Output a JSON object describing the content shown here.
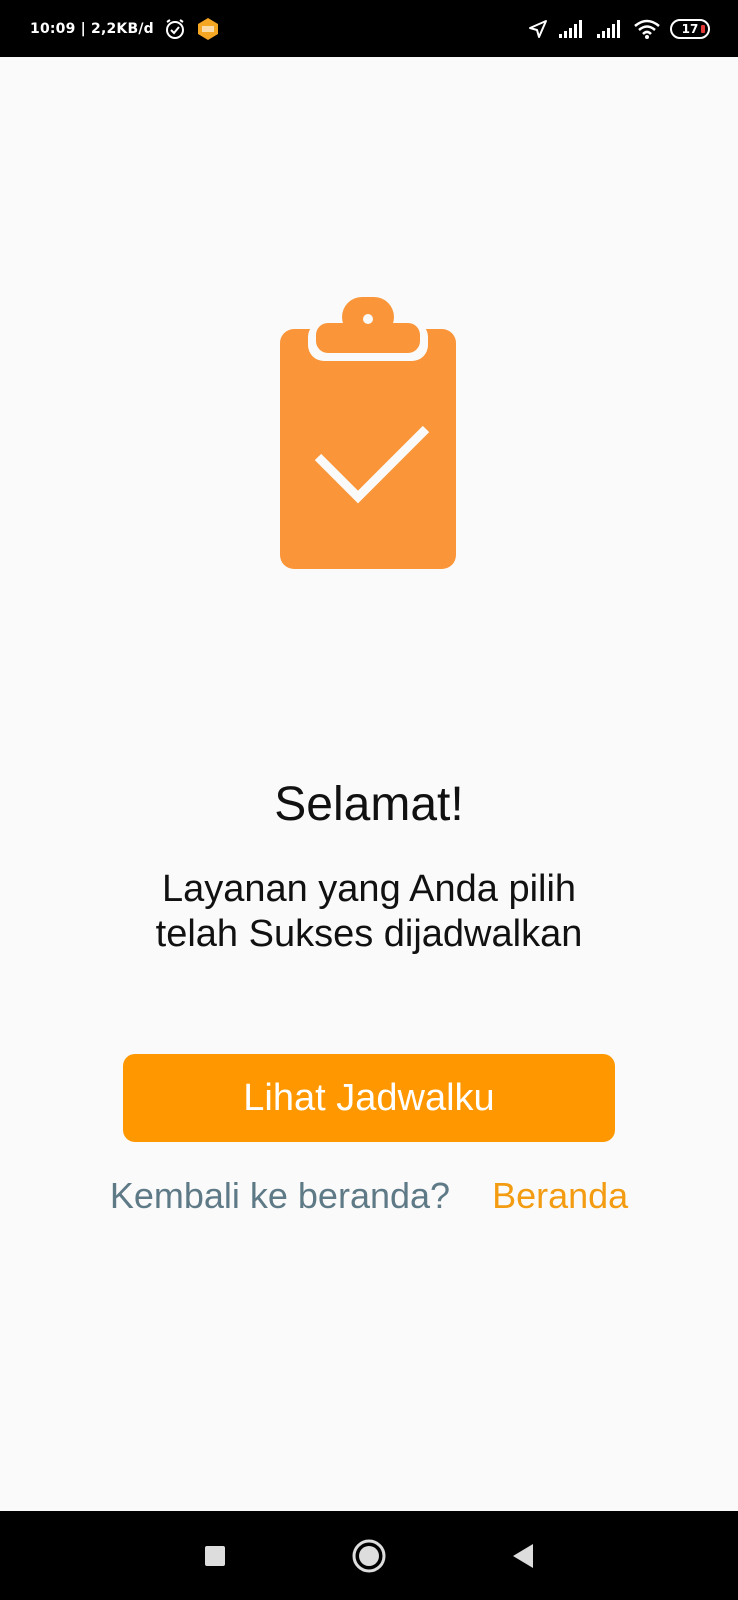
{
  "status_bar": {
    "time": "10:09 | 2,2KB/d",
    "battery": "17",
    "icons": [
      "alarm-icon",
      "app-notification-icon",
      "location-icon",
      "signal-icon",
      "signal-icon",
      "wifi-icon",
      "battery-icon"
    ]
  },
  "colors": {
    "accent": "#FF9800",
    "icon": "#FA9639",
    "link": "#F39C12",
    "muted_text": "#5F7A87",
    "background": "#FAFAFA"
  },
  "success": {
    "icon": "clipboard-check-icon",
    "title": "Selamat!",
    "message_line1": "Layanan yang Anda pilih",
    "message_line2": "telah Sukses dijadwalkan"
  },
  "actions": {
    "primary_label": "Lihat Jadwalku",
    "back_question": "Kembali ke beranda?",
    "back_link": "Beranda"
  },
  "nav_bar": {
    "icons": [
      "recents-square-icon",
      "home-circle-icon",
      "back-triangle-icon"
    ]
  }
}
